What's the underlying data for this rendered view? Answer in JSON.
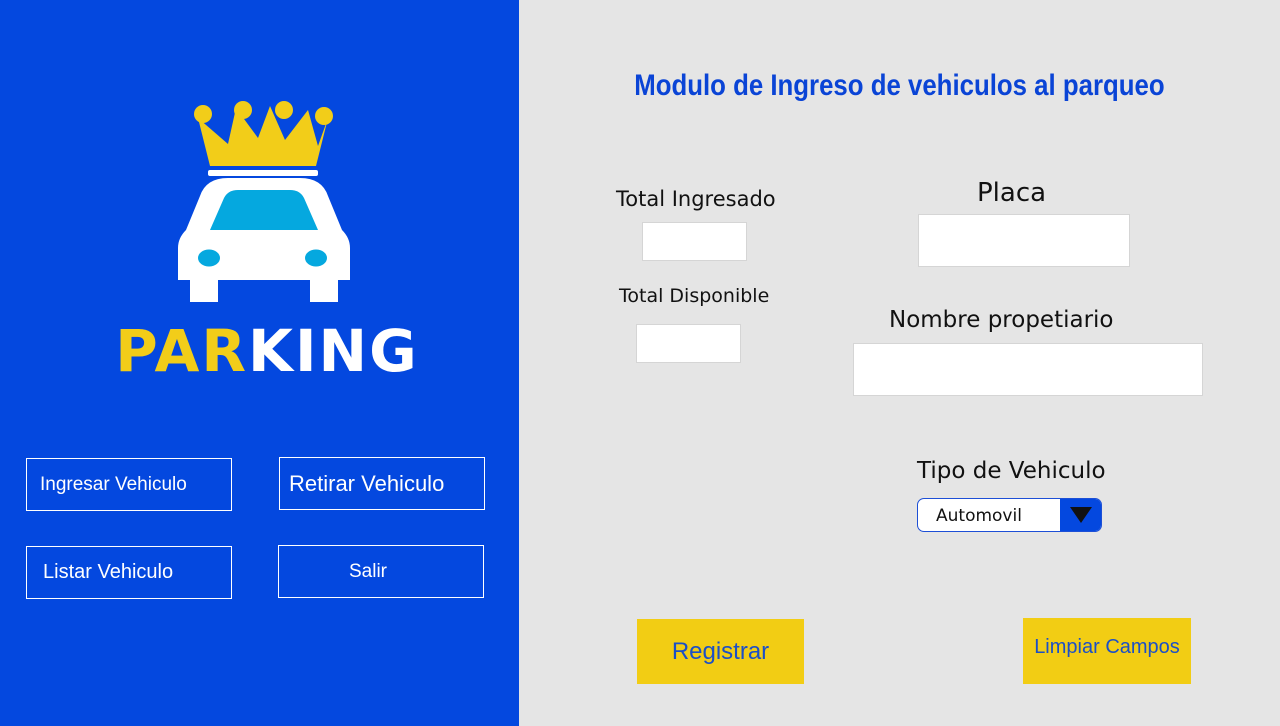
{
  "sidebar": {
    "brand": {
      "part1": "PAR",
      "part2": "KING"
    },
    "logo_icon": "crown-car-icon",
    "buttons": {
      "ingresar": "Ingresar Vehiculo",
      "retirar": "Retirar Vehiculo",
      "listar": "Listar Vehiculo",
      "salir": "Salir"
    }
  },
  "main": {
    "title": "Modulo de Ingreso de vehiculos al parqueo",
    "total_ingresado": {
      "label": "Total Ingresado",
      "value": ""
    },
    "total_disponible": {
      "label": "Total Disponible",
      "value": ""
    },
    "placa": {
      "label": "Placa",
      "value": ""
    },
    "nombre": {
      "label": "Nombre propetiario",
      "value": ""
    },
    "tipo": {
      "label": "Tipo de Vehiculo",
      "selected": "Automovil"
    },
    "buttons": {
      "registrar": "Registrar",
      "limpiar": "Limpiar Campos"
    }
  },
  "colors": {
    "sidebar_bg": "#0448df",
    "main_bg": "#e5e5e5",
    "accent_yellow": "#f2cd14",
    "title_blue": "#0a44d6",
    "car_window": "#05a8df"
  }
}
